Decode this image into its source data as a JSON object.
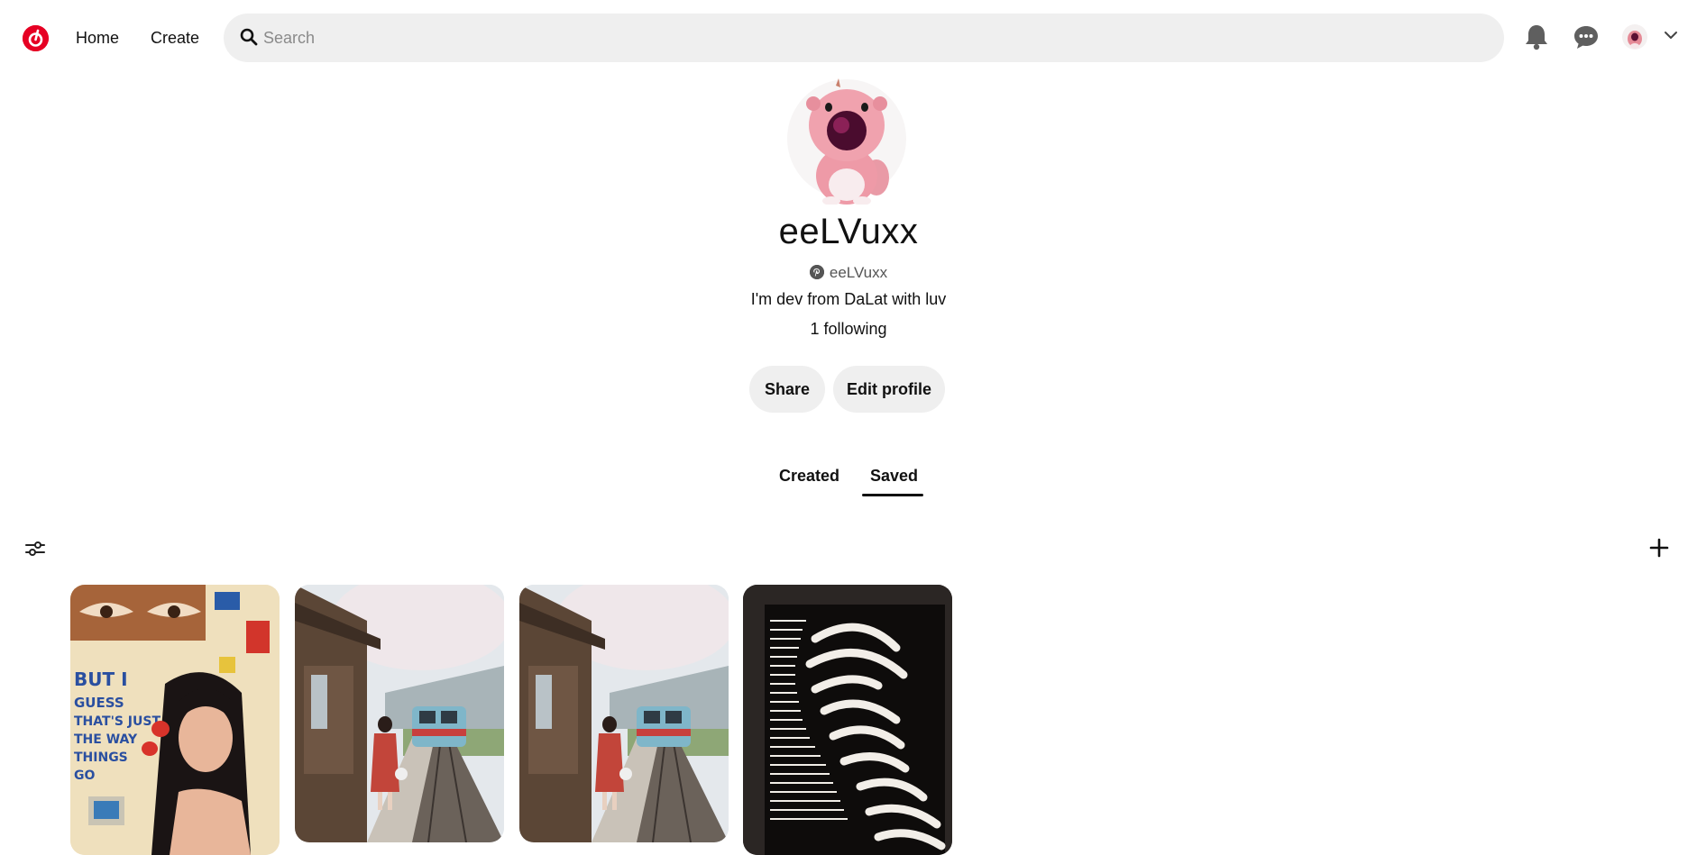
{
  "header": {
    "nav": {
      "home_label": "Home",
      "create_label": "Create"
    },
    "search": {
      "placeholder": "Search",
      "value": ""
    }
  },
  "profile": {
    "display_name": "eeLVuxx",
    "username": "eeLVuxx",
    "bio": "I'm dev from DaLat with luv",
    "following_text": "1 following",
    "share_label": "Share",
    "edit_profile_label": "Edit profile"
  },
  "tabs": [
    {
      "label": "Created",
      "active": false
    },
    {
      "label": "Saved",
      "active": true
    }
  ],
  "colors": {
    "brand": "#e60023",
    "button_bg": "#efefef",
    "text": "#111111"
  },
  "icons": [
    "logo-icon",
    "search-icon",
    "bell-icon",
    "chat-icon",
    "chevron-down-icon",
    "filter-icon",
    "plus-icon"
  ],
  "saved_pins": [
    {
      "name": "collage-illustration-pin"
    },
    {
      "name": "train-station-photo-pin"
    },
    {
      "name": "train-station-photo-pin"
    },
    {
      "name": "striped-portrait-pin"
    }
  ]
}
